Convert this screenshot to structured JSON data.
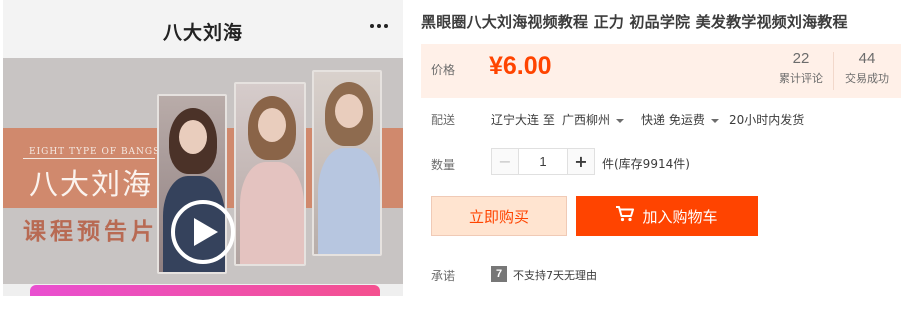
{
  "preview": {
    "title": "八大刘海",
    "more_icon": "more-dots-icon",
    "cover": {
      "en_title": "EIGHT TYPE OF BANGS",
      "cn_title": "八大刘海",
      "trailer_title": "课程预告片",
      "play_icon": "play-icon"
    }
  },
  "product": {
    "title": "黑眼圈八大刘海视频教程 正力 初品学院 美发教学视频刘海教程"
  },
  "price": {
    "label": "价格",
    "value": "¥6.00",
    "reviews_count": "22",
    "reviews_label": "累计评论",
    "deals_count": "44",
    "deals_label": "交易成功"
  },
  "shipping": {
    "label": "配送",
    "from": "辽宁大连",
    "to_word": "至",
    "destination": "广西柳州",
    "method": "快递 免运费",
    "dispatch": "20小时内发货"
  },
  "quantity": {
    "label": "数量",
    "minus": "−",
    "value": "1",
    "plus": "+",
    "stock": "件(库存9914件)"
  },
  "actions": {
    "buy_now": "立即购买",
    "add_to_cart": "加入购物车",
    "cart_icon": "cart-icon"
  },
  "promise": {
    "label": "承诺",
    "badge": "7",
    "text": "不支持7天无理由"
  },
  "colors": {
    "accent": "#ff4400",
    "price_bg": "#fff0e8",
    "buy_now_bg": "#ffe4d0"
  }
}
